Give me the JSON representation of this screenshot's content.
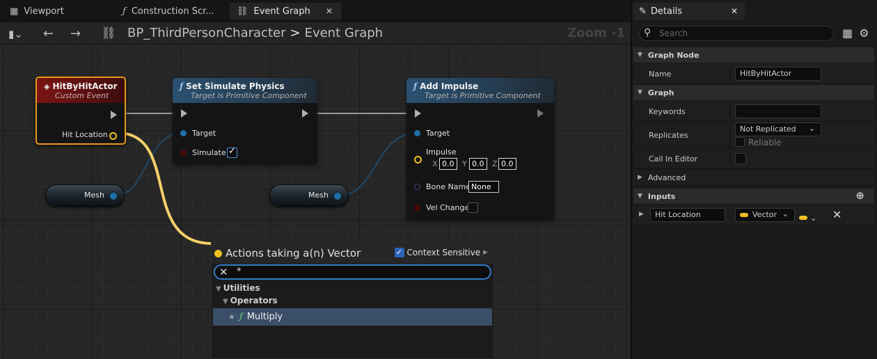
{
  "tabs": [
    {
      "label": "Viewport",
      "icon": "viewport-icon"
    },
    {
      "label": "Construction Scr...",
      "icon": "function-icon"
    },
    {
      "label": "Event Graph",
      "icon": "graph-icon",
      "active": true
    }
  ],
  "toolbar": {
    "breadcrumb_root": "BP_ThirdPersonCharacter",
    "breadcrumb_sep": ">",
    "breadcrumb_leaf": "Event Graph",
    "zoom": "Zoom -1"
  },
  "nodes": {
    "event": {
      "title": "HitByHitActor",
      "subtitle": "Custom Event",
      "pin_hit_location": "Hit Location"
    },
    "set_physics": {
      "title": "Set Simulate Physics",
      "subtitle": "Target is Primitive Component",
      "pin_target": "Target",
      "pin_simulate": "Simulate",
      "simulate_checked": true
    },
    "add_impulse": {
      "title": "Add Impulse",
      "subtitle": "Target is Primitive Component",
      "pin_target": "Target",
      "pin_impulse": "Impulse",
      "x_label": "X",
      "x": "0.0",
      "y_label": "Y",
      "y": "0.0",
      "z_label": "Z",
      "z": "0.0",
      "pin_bone": "Bone Name",
      "bone_value": "None",
      "pin_vel": "Vel Change"
    },
    "mesh1": {
      "label": "Mesh"
    },
    "mesh2": {
      "label": "Mesh"
    }
  },
  "action_menu": {
    "title": "Actions taking a(n) Vector",
    "context_label": "Context Sensitive",
    "context_checked": true,
    "search_value": "*",
    "categories": [
      {
        "label": "Utilities"
      },
      {
        "label": "Operators"
      }
    ],
    "items": [
      {
        "label": "Multiply",
        "selected": true
      }
    ]
  },
  "details": {
    "tab": "Details",
    "search_placeholder": "Search",
    "sections": {
      "graph_node": "Graph Node",
      "graph": "Graph",
      "advanced": "Advanced",
      "inputs": "Inputs"
    },
    "name_label": "Name",
    "name_value": "HitByHitActor",
    "keywords_label": "Keywords",
    "keywords_value": "",
    "replicates_label": "Replicates",
    "replicates_value": "Not Replicated",
    "reliable_label": "Reliable",
    "call_in_editor_label": "Call In Editor",
    "input_name": "Hit Location",
    "input_type": "Vector"
  },
  "colors": {
    "vector_pin": "#f0c020",
    "object_pin": "#1e6fa8",
    "function_header": "#2a5070",
    "event_header": "#7a1414",
    "selection_accent": "#2f7ec9"
  }
}
